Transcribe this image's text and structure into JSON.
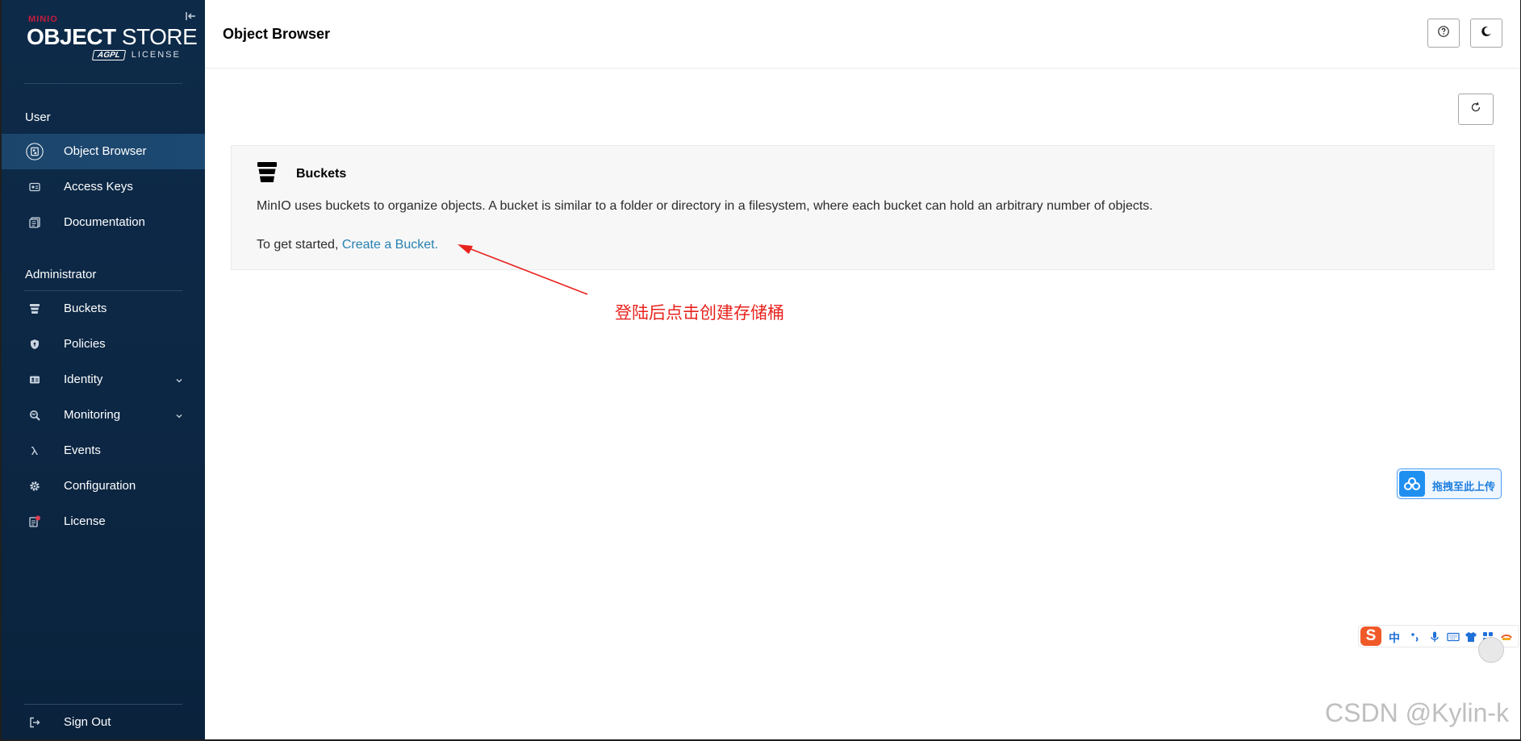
{
  "sidebar": {
    "logo": {
      "brand": "MINIO",
      "product_bold": "OBJECT",
      "product_thin": "STORE",
      "license_badge": "AGPL",
      "license_text": "LICENSE"
    },
    "sections": [
      {
        "title": "User",
        "items": [
          {
            "label": "Object Browser",
            "icon": "object-browser-icon",
            "active": true
          },
          {
            "label": "Access Keys",
            "icon": "access-keys-icon"
          },
          {
            "label": "Documentation",
            "icon": "documentation-icon"
          }
        ]
      },
      {
        "title": "Administrator",
        "items": [
          {
            "label": "Buckets",
            "icon": "buckets-icon"
          },
          {
            "label": "Policies",
            "icon": "policies-icon"
          },
          {
            "label": "Identity",
            "icon": "identity-icon",
            "expandable": true
          },
          {
            "label": "Monitoring",
            "icon": "monitoring-icon",
            "expandable": true
          },
          {
            "label": "Events",
            "icon": "lambda-icon"
          },
          {
            "label": "Configuration",
            "icon": "gear-icon"
          },
          {
            "label": "License",
            "icon": "license-icon",
            "badge": true
          }
        ]
      }
    ],
    "sign_out": {
      "label": "Sign Out",
      "icon": "sign-out-icon"
    }
  },
  "header": {
    "title": "Object Browser",
    "help_icon": "help-icon",
    "theme_icon": "dark-mode-icon"
  },
  "main": {
    "refresh_icon": "refresh-icon",
    "panel": {
      "title": "Buckets",
      "description": "MinIO uses buckets to organize objects. A bucket is similar to a folder or directory in a filesystem, where each bucket can hold an arbitrary number of objects.",
      "start_prefix": "To get started, ",
      "start_link": "Create a Bucket."
    },
    "annotation": "登陆后点击创建存储桶"
  },
  "overlays": {
    "upload_widget_label": "拖拽至此上传",
    "ime_logo": "S",
    "ime_mode": "中",
    "watermark": "CSDN @Kylin-k"
  },
  "colors": {
    "sidebar_bg": "#0c2744",
    "accent_red": "#c51c3f",
    "link": "#2781b0",
    "annotation": "#e8231e"
  }
}
